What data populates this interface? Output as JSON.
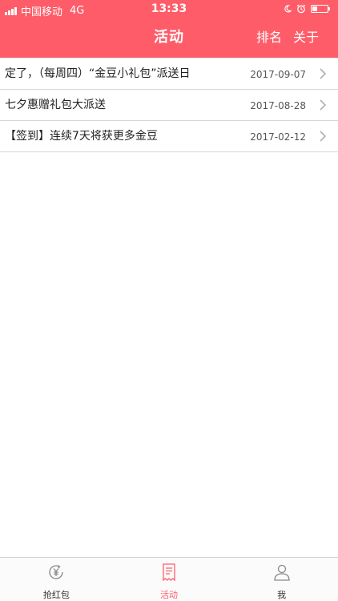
{
  "theme": {
    "accent": "#fe5c69",
    "tab_inactive": "#888888",
    "text": "#222222"
  },
  "status_bar": {
    "carrier": "中国移动",
    "network": "4G",
    "time": "13:33",
    "icons": [
      "signal-icon",
      "moon-icon",
      "alarm-icon",
      "battery-icon"
    ],
    "battery_level": 0.35
  },
  "nav": {
    "title": "活动",
    "rank_label": "排名",
    "about_label": "关于"
  },
  "list": {
    "items": [
      {
        "title": "定了，（每周四）“金豆小礼包”派送日",
        "date": "2017-09-07"
      },
      {
        "title": "七夕惠赠礼包大派送",
        "date": "2017-08-28"
      },
      {
        "title": "【签到】连续7天将获更多金豆",
        "date": "2017-02-12"
      }
    ]
  },
  "tabs": [
    {
      "label": "抢红包",
      "icon": "yuan-coin-icon",
      "active": false
    },
    {
      "label": "活动",
      "icon": "receipt-icon",
      "active": true
    },
    {
      "label": "我",
      "icon": "person-icon",
      "active": false
    }
  ]
}
